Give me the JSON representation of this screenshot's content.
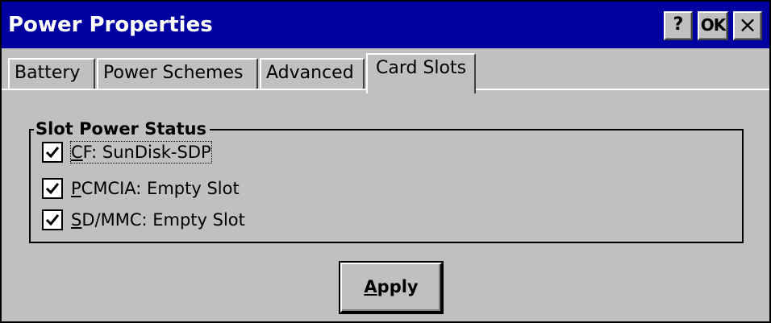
{
  "window": {
    "title": "Power Properties",
    "buttons": {
      "help": "?",
      "ok": "OK",
      "close": "×"
    }
  },
  "tabs": [
    {
      "label": "Battery",
      "active": false
    },
    {
      "label": "Power Schemes",
      "active": false
    },
    {
      "label": "Advanced",
      "active": false
    },
    {
      "label": "Card Slots",
      "active": true
    }
  ],
  "group": {
    "title": "Slot Power Status",
    "slots": [
      {
        "mnemonic": "C",
        "rest": "F: SunDisk-SDP",
        "checked": true,
        "focused": true
      },
      {
        "mnemonic": "P",
        "rest": "CMCIA: Empty Slot",
        "checked": true,
        "focused": false
      },
      {
        "mnemonic": "S",
        "rest": "D/MMC: Empty Slot",
        "checked": true,
        "focused": false
      }
    ]
  },
  "apply": {
    "mnemonic": "A",
    "rest": "pply"
  },
  "colors": {
    "titlebar": "#0000a0",
    "face": "#c0c0c0"
  }
}
